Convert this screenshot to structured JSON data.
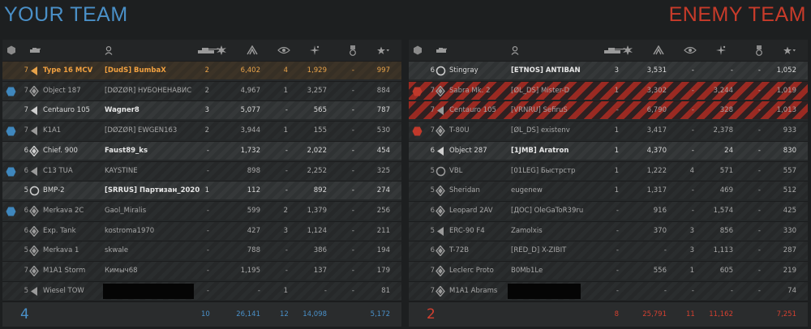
{
  "your_team": {
    "title": "YOUR TEAM",
    "color": "#4a90c8",
    "rows": [
      {
        "tier": "7",
        "tank": "Type 16 MCV",
        "player": "[DudS] BumbaX",
        "kills": "2",
        "damage": "6,402",
        "spots": "4",
        "assist": "1,929",
        "blocked": "-",
        "xp": "997",
        "style": "me",
        "cls": "td",
        "platoon": false
      },
      {
        "tier": "7",
        "tank": "Object 187",
        "player": "[DØZØR] НУБОНЕНАВИС",
        "kills": "2",
        "damage": "4,967",
        "spots": "1",
        "assist": "3,257",
        "blocked": "-",
        "xp": "884",
        "style": "normal",
        "cls": "medium",
        "platoon": true
      },
      {
        "tier": "7",
        "tank": "Centauro 105",
        "player": "Wagner8",
        "kills": "3",
        "damage": "5,077",
        "spots": "-",
        "assist": "565",
        "blocked": "-",
        "xp": "787",
        "style": "bright",
        "cls": "td",
        "platoon": false
      },
      {
        "tier": "7",
        "tank": "K1A1",
        "player": "[DØZØR] EWGEN163",
        "kills": "2",
        "damage": "3,944",
        "spots": "1",
        "assist": "155",
        "blocked": "-",
        "xp": "530",
        "style": "normal",
        "cls": "td",
        "platoon": true
      },
      {
        "tier": "6",
        "tank": "Chief. 900",
        "player": "Faust89_ks",
        "kills": "-",
        "damage": "1,732",
        "spots": "-",
        "assist": "2,022",
        "blocked": "-",
        "xp": "454",
        "style": "bright",
        "cls": "medium",
        "platoon": false
      },
      {
        "tier": "6",
        "tank": "C13 TUA",
        "player": "KAYSTINE",
        "kills": "-",
        "damage": "898",
        "spots": "-",
        "assist": "2,252",
        "blocked": "-",
        "xp": "325",
        "style": "normal",
        "cls": "td",
        "platoon": true
      },
      {
        "tier": "5",
        "tank": "BMP-2",
        "player": "[SRRUS] Партизан_2020",
        "kills": "1",
        "damage": "112",
        "spots": "-",
        "assist": "892",
        "blocked": "-",
        "xp": "274",
        "style": "bright",
        "cls": "recon",
        "platoon": false
      },
      {
        "tier": "6",
        "tank": "Merkava 2C",
        "player": "Gaol_Miralis",
        "kills": "-",
        "damage": "599",
        "spots": "2",
        "assist": "1,379",
        "blocked": "-",
        "xp": "256",
        "style": "normal",
        "cls": "medium",
        "platoon": true
      },
      {
        "tier": "6",
        "tank": "Exp. Tank",
        "player": "kostroma1970",
        "kills": "-",
        "damage": "427",
        "spots": "3",
        "assist": "1,124",
        "blocked": "-",
        "xp": "211",
        "style": "normal",
        "cls": "medium",
        "platoon": false
      },
      {
        "tier": "5",
        "tank": "Merkava 1",
        "player": "skwale",
        "kills": "-",
        "damage": "788",
        "spots": "-",
        "assist": "386",
        "blocked": "-",
        "xp": "194",
        "style": "normal",
        "cls": "medium",
        "platoon": false
      },
      {
        "tier": "7",
        "tank": "M1A1 Storm",
        "player": "Кимыч68",
        "kills": "-",
        "damage": "1,195",
        "spots": "-",
        "assist": "137",
        "blocked": "-",
        "xp": "179",
        "style": "normal",
        "cls": "medium",
        "platoon": false
      },
      {
        "tier": "5",
        "tank": "Wiesel TOW",
        "player": "",
        "kills": "-",
        "damage": "-",
        "spots": "1",
        "assist": "-",
        "blocked": "-",
        "xp": "81",
        "style": "normal",
        "cls": "td",
        "platoon": false,
        "redacted": true
      }
    ],
    "totals": {
      "score": "4",
      "kills": "10",
      "damage": "26,141",
      "spots": "12",
      "assist": "14,098",
      "xp": "5,172"
    }
  },
  "enemy_team": {
    "title": "ENEMY TEAM",
    "color": "#c83b2a",
    "rows": [
      {
        "tier": "6",
        "tank": "Stingray",
        "player": "[ETNOS] ANTIBAN",
        "kills": "3",
        "damage": "3,531",
        "spots": "-",
        "assist": "-",
        "blocked": "-",
        "xp": "1,052",
        "style": "bright",
        "cls": "recon",
        "platoon": false
      },
      {
        "tier": "7",
        "tank": "Sabra Mk. 2",
        "player": "[ØL_DS] Mister-D",
        "kills": "1",
        "damage": "3,302",
        "spots": "-",
        "assist": "3,244",
        "blocked": "-",
        "xp": "1,019",
        "style": "dead",
        "cls": "medium",
        "platoon": true
      },
      {
        "tier": "7",
        "tank": "Centauro 105",
        "player": "[VRNRU] SefiruS",
        "kills": "-",
        "damage": "6,790",
        "spots": "-",
        "assist": "328",
        "blocked": "-",
        "xp": "1,013",
        "style": "dead",
        "cls": "td",
        "platoon": false
      },
      {
        "tier": "7",
        "tank": "T-80U",
        "player": "[ØL_DS] existenv",
        "kills": "1",
        "damage": "3,417",
        "spots": "-",
        "assist": "2,378",
        "blocked": "-",
        "xp": "933",
        "style": "normal",
        "cls": "medium",
        "platoon": true
      },
      {
        "tier": "6",
        "tank": "Object 287",
        "player": "[1JMB] Aratron",
        "kills": "1",
        "damage": "4,370",
        "spots": "-",
        "assist": "24",
        "blocked": "-",
        "xp": "830",
        "style": "bright",
        "cls": "td",
        "platoon": false
      },
      {
        "tier": "5",
        "tank": "VBL",
        "player": "[01LEG] Быстрстр",
        "kills": "1",
        "damage": "1,222",
        "spots": "4",
        "assist": "571",
        "blocked": "-",
        "xp": "557",
        "style": "normal",
        "cls": "recon",
        "platoon": false
      },
      {
        "tier": "5",
        "tank": "Sheridan",
        "player": "eugenew",
        "kills": "1",
        "damage": "1,317",
        "spots": "-",
        "assist": "469",
        "blocked": "-",
        "xp": "512",
        "style": "normal",
        "cls": "medium",
        "platoon": false
      },
      {
        "tier": "6",
        "tank": "Leopard 2AV",
        "player": "[ДОС] OleGaToR39ru",
        "kills": "-",
        "damage": "916",
        "spots": "-",
        "assist": "1,574",
        "blocked": "-",
        "xp": "425",
        "style": "normal",
        "cls": "medium",
        "platoon": false
      },
      {
        "tier": "5",
        "tank": "ERC-90 F4",
        "player": "Zamolxis",
        "kills": "-",
        "damage": "370",
        "spots": "3",
        "assist": "856",
        "blocked": "-",
        "xp": "330",
        "style": "normal",
        "cls": "td",
        "platoon": false
      },
      {
        "tier": "6",
        "tank": "T-72B",
        "player": "[RED_D] X-ZIBIT",
        "kills": "-",
        "damage": "-",
        "spots": "3",
        "assist": "1,113",
        "blocked": "-",
        "xp": "287",
        "style": "normal",
        "cls": "medium",
        "platoon": false
      },
      {
        "tier": "7",
        "tank": "Leclerc Proto",
        "player": "B0Mb1Le",
        "kills": "-",
        "damage": "556",
        "spots": "1",
        "assist": "605",
        "blocked": "-",
        "xp": "219",
        "style": "normal",
        "cls": "medium",
        "platoon": false
      },
      {
        "tier": "7",
        "tank": "M1A1 Abrams",
        "player": "",
        "kills": "-",
        "damage": "-",
        "spots": "-",
        "assist": "-",
        "blocked": "-",
        "xp": "74",
        "style": "normal",
        "cls": "medium",
        "platoon": false,
        "redacted": true
      }
    ],
    "totals": {
      "score": "2",
      "kills": "8",
      "damage": "25,791",
      "spots": "11",
      "assist": "11,162",
      "xp": "7,251"
    }
  },
  "columns": [
    {
      "key": "kills",
      "icon": "kills-icon"
    },
    {
      "key": "damage",
      "icon": "damage-icon"
    },
    {
      "key": "spots",
      "icon": "spots-eye-icon"
    },
    {
      "key": "assist",
      "icon": "assist-icon"
    },
    {
      "key": "blocked",
      "icon": "medal-icon"
    },
    {
      "key": "xp",
      "icon": "xp-star-sort-icon"
    }
  ]
}
